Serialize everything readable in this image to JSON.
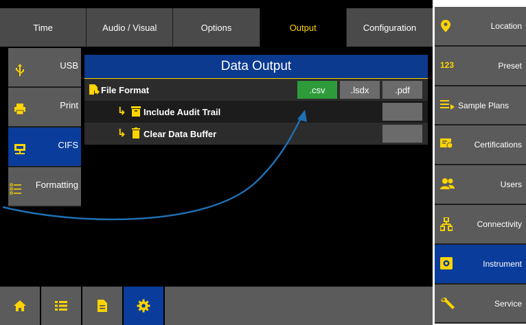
{
  "colors": {
    "accent_yellow": "#ffd400",
    "active_blue": "#0a3d9b",
    "selected_green": "#2e9b3a",
    "button_gray": "#5b5b5b",
    "annotation_arrow": "#1f6fb2"
  },
  "top_tabs": [
    "Time",
    "Audio / Visual",
    "Options",
    "Output",
    "Configuration"
  ],
  "active_tab": "Output",
  "left_nav": [
    {
      "label": "USB",
      "icon": "usb-icon"
    },
    {
      "label": "Print",
      "icon": "printer-icon"
    },
    {
      "label": "CIFS",
      "icon": "network-share-icon"
    },
    {
      "label": "Formatting",
      "icon": "list-format-icon"
    }
  ],
  "active_left": "CIFS",
  "panel": {
    "title": "Data Output",
    "file_format_label": "File Format",
    "formats": [
      ".csv",
      ".lsdx",
      ".pdf"
    ],
    "selected_format": ".csv",
    "include_audit_trail": "Include Audit Trail",
    "clear_data_buffer": "Clear Data Buffer"
  },
  "right_nav": [
    {
      "label": "Location",
      "icon": "location-pin-icon"
    },
    {
      "label": "Preset",
      "icon": "numbers-123-icon"
    },
    {
      "label": "Sample Plans",
      "icon": "sample-plans-icon"
    },
    {
      "label": "Certifications",
      "icon": "certificate-icon"
    },
    {
      "label": "Users",
      "icon": "users-icon"
    },
    {
      "label": "Connectivity",
      "icon": "network-icon"
    },
    {
      "label": "Instrument",
      "icon": "instrument-gear-icon"
    },
    {
      "label": "Service",
      "icon": "wrench-icon"
    }
  ],
  "active_right": "Instrument",
  "bottom_bar": [
    {
      "icon": "home-icon"
    },
    {
      "icon": "list-icon"
    },
    {
      "icon": "document-icon"
    },
    {
      "icon": "settings-gear-icon"
    }
  ]
}
